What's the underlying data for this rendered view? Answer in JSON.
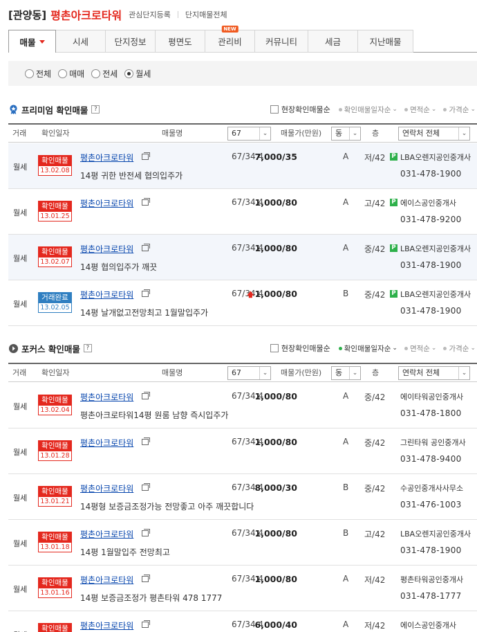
{
  "header": {
    "region": "[관양동]",
    "complex": "평촌아크로타워",
    "link1": "관심단지등록",
    "link2": "단지매물전체"
  },
  "tabs": [
    {
      "label": "매물",
      "active": true
    },
    {
      "label": "시세"
    },
    {
      "label": "단지정보"
    },
    {
      "label": "평면도"
    },
    {
      "label": "관리비",
      "badge": "NEW"
    },
    {
      "label": "커뮤니티"
    },
    {
      "label": "세금"
    },
    {
      "label": "지난매물"
    }
  ],
  "filter": {
    "options": [
      {
        "label": "전체",
        "checked": false
      },
      {
        "label": "매매",
        "checked": false
      },
      {
        "label": "전세",
        "checked": false
      },
      {
        "label": "월세",
        "checked": true
      }
    ]
  },
  "premium": {
    "title": "프리미엄 확인매물",
    "help": "?",
    "checkbox_label": "현장확인매물순",
    "sorts": [
      {
        "label": "확인매물일자순",
        "active": false
      },
      {
        "label": "면적순",
        "active": false
      },
      {
        "label": "가격순",
        "active": false
      }
    ],
    "header": {
      "type": "거래",
      "date": "확인일자",
      "name": "매물명",
      "area_select": "67",
      "price": "매물가(만원)",
      "dong_select": "동",
      "floor": "층",
      "agent_select": "연락처 전체"
    },
    "rows": [
      {
        "type": "월세",
        "badge": "확인매물",
        "date": "13.02.08",
        "name": "평촌아크로타워",
        "desc": "14평 귀한 반전세 협의입주가",
        "area": "67/34.4",
        "price": "7,000/35",
        "up": false,
        "dong": "A",
        "floor": "저/42",
        "agent": "LBA오렌지공인중개사",
        "phone": "031-478-1900",
        "premium": true,
        "hl": true
      },
      {
        "type": "월세",
        "badge": "확인매물",
        "date": "13.01.25",
        "name": "평촌아크로타워",
        "desc": "",
        "area": "67/34.4",
        "price": "1,000/80",
        "up": false,
        "dong": "A",
        "floor": "고/42",
        "agent": "에이스공인중개사",
        "phone": "031-478-9200",
        "premium": true,
        "hl": false
      },
      {
        "type": "월세",
        "badge": "확인매물",
        "date": "13.02.07",
        "name": "평촌아크로타워",
        "desc": "14평 협의입주가 깨끗",
        "area": "67/34.4",
        "price": "1,000/80",
        "up": false,
        "dong": "A",
        "floor": "중/42",
        "agent": "LBA오렌지공인중개사",
        "phone": "031-478-1900",
        "premium": true,
        "hl": true
      },
      {
        "type": "월세",
        "badge": "거래완료",
        "date": "13.02.05",
        "name": "평촌아크로타워",
        "desc": "14평 날개없고전망최고 1월말입주가",
        "area": "67/34.4",
        "price": "1,000/80",
        "up": true,
        "dong": "B",
        "floor": "중/42",
        "agent": "LBA오렌지공인중개사",
        "phone": "031-478-1900",
        "premium": true,
        "hl": false,
        "done": true
      }
    ]
  },
  "focus": {
    "title": "포커스 확인매물",
    "help": "?",
    "checkbox_label": "현장확인매물순",
    "sorts": [
      {
        "label": "확인매물일자순",
        "active": true
      },
      {
        "label": "면적순",
        "active": false
      },
      {
        "label": "가격순",
        "active": false
      }
    ],
    "header": {
      "type": "거래",
      "date": "확인일자",
      "name": "매물명",
      "area_select": "67",
      "price": "매물가(만원)",
      "dong_select": "동",
      "floor": "층",
      "agent_select": "연락처 전체"
    },
    "rows": [
      {
        "type": "월세",
        "badge": "확인매물",
        "date": "13.02.04",
        "name": "평촌아크로타워",
        "desc": "평촌아크로타워14평 원룸 남향 즉시입주가",
        "area": "67/34.4",
        "price": "1,000/80",
        "dong": "A",
        "floor": "중/42",
        "agent": "에이타워공인중개사",
        "phone": "031-478-1800"
      },
      {
        "type": "월세",
        "badge": "확인매물",
        "date": "13.01.28",
        "name": "평촌아크로타워",
        "desc": "",
        "area": "67/34.4",
        "price": "1,000/80",
        "dong": "A",
        "floor": "중/42",
        "agent": "그린타워 공인중개사",
        "phone": "031-478-9400"
      },
      {
        "type": "월세",
        "badge": "확인매물",
        "date": "13.01.21",
        "name": "평촌아크로타워",
        "desc": "14평형 보증금조정가능 전망좋고 아주 깨끗합니다",
        "area": "67/34.4",
        "price": "8,000/30",
        "dong": "B",
        "floor": "중/42",
        "agent": "수공인중개사사무소",
        "phone": "031-476-1003"
      },
      {
        "type": "월세",
        "badge": "확인매물",
        "date": "13.01.18",
        "name": "평촌아크로타워",
        "desc": "14평 1월말입주 전망최고",
        "area": "67/34.4",
        "price": "1,000/80",
        "dong": "B",
        "floor": "고/42",
        "agent": "LBA오렌지공인중개사",
        "phone": "031-478-1900"
      },
      {
        "type": "월세",
        "badge": "확인매물",
        "date": "13.01.16",
        "name": "평촌아크로타워",
        "desc": "14평 보증금조정가 평촌타워 478 1777",
        "area": "67/34.4",
        "price": "1,000/80",
        "dong": "A",
        "floor": "저/42",
        "agent": "평촌타워공인중개사",
        "phone": "031-478-1777"
      },
      {
        "type": "월세",
        "badge": "확인매물",
        "date": "",
        "name": "평촌아크로타워",
        "desc": "",
        "area": "67/34.4",
        "price": "6,000/40",
        "dong": "A",
        "floor": "저/42",
        "agent": "에이스공인중개사",
        "phone": ""
      }
    ]
  }
}
